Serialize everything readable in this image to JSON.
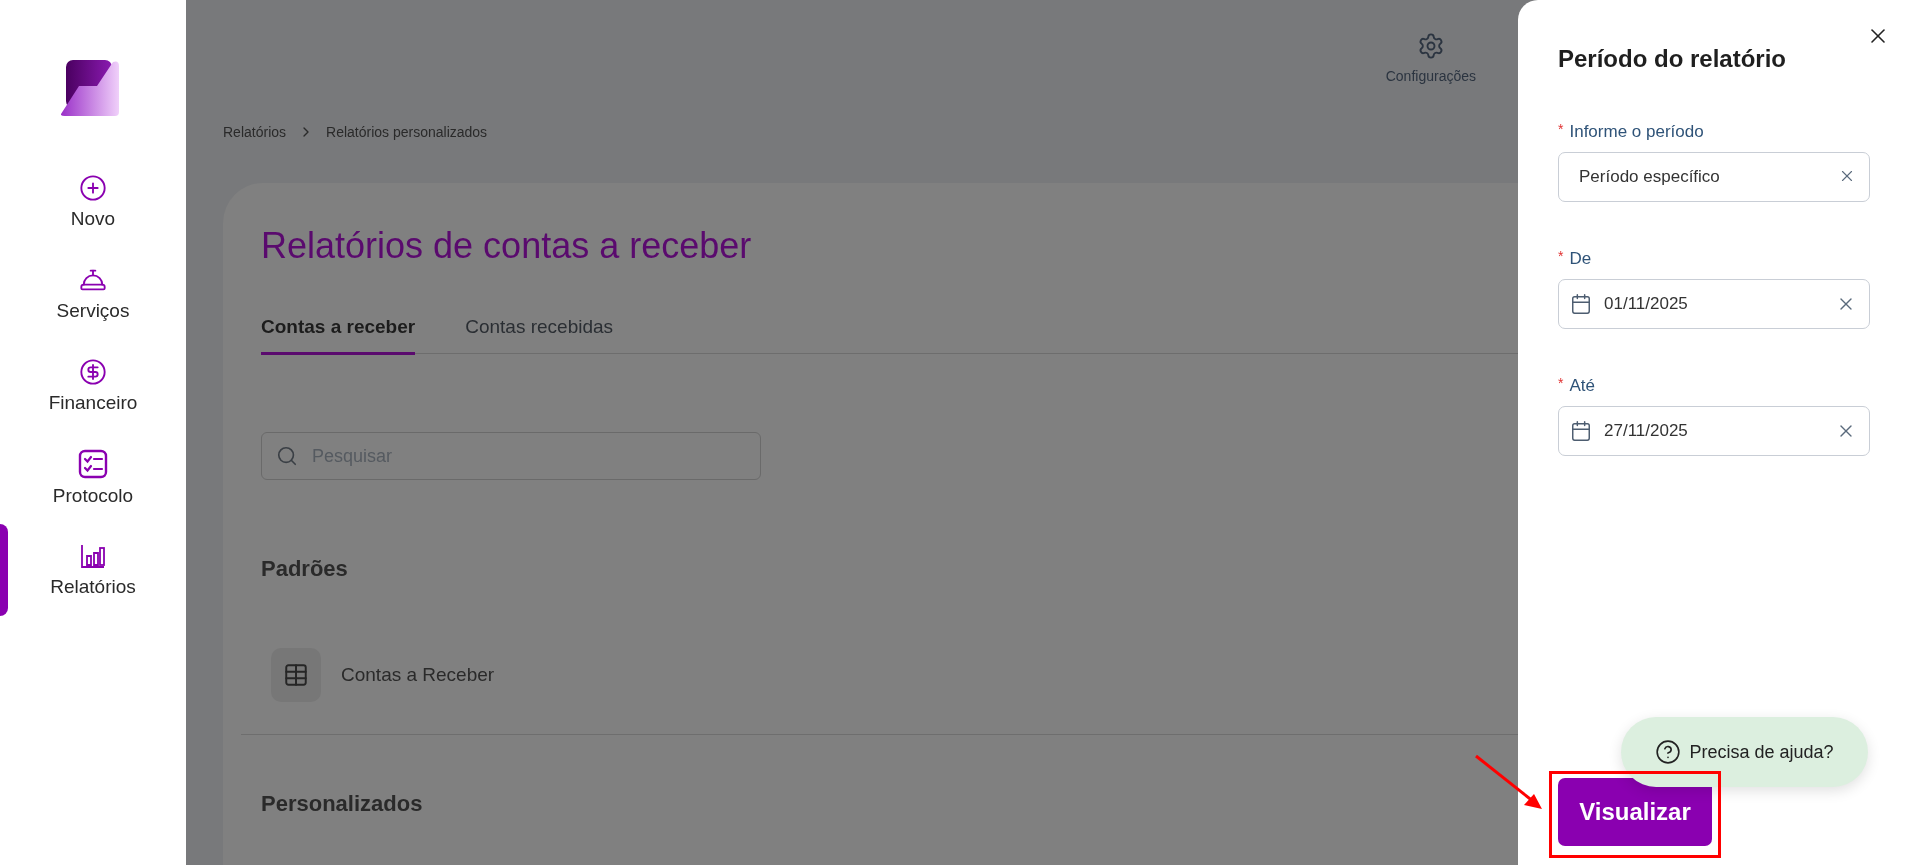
{
  "sidebar": {
    "items": [
      {
        "label": "Novo",
        "selected": false
      },
      {
        "label": "Serviços",
        "selected": false
      },
      {
        "label": "Financeiro",
        "selected": false
      },
      {
        "label": "Protocolo",
        "selected": false
      },
      {
        "label": "Relatórios",
        "selected": true
      }
    ]
  },
  "header": {
    "actions": [
      {
        "label": "Configurações"
      }
    ]
  },
  "breadcrumb": [
    "Relatórios",
    "Relatórios personalizados"
  ],
  "page": {
    "title": "Relatórios de contas a receber",
    "tabs": [
      {
        "label": "Contas a receber",
        "selected": true
      },
      {
        "label": "Contas recebidas",
        "selected": false
      }
    ],
    "search": {
      "placeholder": "Pesquisar"
    },
    "sections": [
      {
        "title": "Padrões",
        "items": [
          {
            "label": "Contas a Receber"
          }
        ]
      },
      {
        "title": "Personalizados"
      }
    ]
  },
  "drawer": {
    "title": "Período do relatório",
    "fields": [
      {
        "kind": "select",
        "required_mark": "*",
        "label": "Informe o período",
        "value": "Período específico"
      },
      {
        "kind": "date",
        "required_mark": "*",
        "label": "De",
        "value": "01/11/2025"
      },
      {
        "kind": "date",
        "required_mark": "*",
        "label": "Até",
        "value": "27/11/2025"
      }
    ],
    "submit": "Visualizar"
  },
  "help": {
    "label": "Precisa de ajuda?"
  },
  "annotation": {
    "kind": "box-arrow"
  }
}
